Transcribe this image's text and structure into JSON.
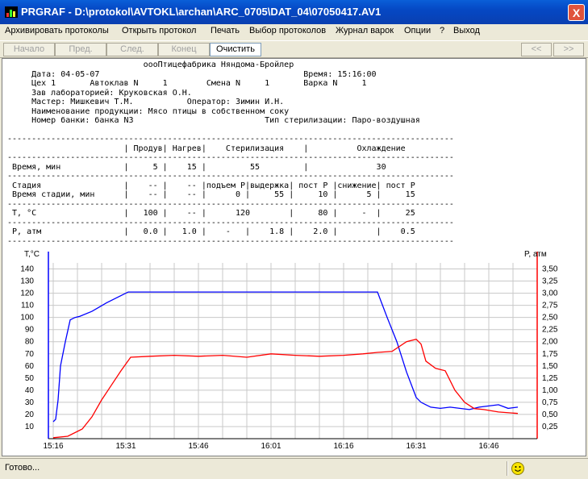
{
  "window": {
    "title": "PRGRAF - D:\\protokol\\AVTOKL\\archan\\ARC_0705\\DAT_04\\07050417.AV1",
    "close": "X"
  },
  "menu": [
    "Архивировать протоколы",
    "Открыть протокол",
    "Печать",
    "Выбор протоколов",
    "Журнал варок",
    "Опции",
    "?",
    "Выход"
  ],
  "toolbar": {
    "start": "Начало",
    "prev": "Пред.",
    "next": "След.",
    "end": "Конец",
    "clear": "Очистить",
    "rewind": "<<",
    "forward": ">>"
  },
  "report": {
    "lines": [
      "                            oooПтицефабрика Няндома-Бройлер",
      "     Дата: 04-05-07                                          Время: 15:16:00",
      "     Цех 1       Автоклав N     1        Смена N     1       Варка N     1",
      "     Зав лабораторией: Круковская О.Н.",
      "     Мастер: Мишкевич Т.М.           Оператор: Зимин И.Н.",
      "     Наименование продукции: Мясо птицы в собственном соку",
      "     Номер банки: банка N3                           Тип стерилизации: Паро-воздушная",
      "",
      "--------------------------------------------------------------------------------------------",
      "                        | Продув| Нагрев|    Стерилизация    |          Охлаждение",
      "--------------------------------------------------------------------------------------------",
      " Время, мин             |     5 |    15 |         55         |              30",
      "--------------------------------------------------------------------------------------------",
      " Стадия                 |    -- |    -- |подъем P|выдержка| пост P |снижение| пост P",
      " Время стадии, мин      |    -- |    -- |      0 |     55 |     10 |      5 |     15",
      "--------------------------------------------------------------------------------------------",
      " T, °C                  |   100 |    -- |      120        |     80 |     -  |     25",
      "--------------------------------------------------------------------------------------------",
      " P, атм                 |   0.0 |   1.0 |    -   |    1.8 |    2.0 |        |    0.5",
      "--------------------------------------------------------------------------------------------"
    ]
  },
  "chart_data": {
    "type": "line",
    "left_axis_label": "T,°C",
    "right_axis_label": "P, атм",
    "x_labels": [
      "15:16",
      "15:31",
      "15:46",
      "16:01",
      "16:16",
      "16:31",
      "16:46"
    ],
    "x_minutes": [
      0,
      15,
      30,
      45,
      60,
      75,
      90
    ],
    "xlim": [
      -1,
      100
    ],
    "left_ylim": [
      0,
      145
    ],
    "left_ticks": [
      10,
      20,
      30,
      40,
      50,
      60,
      70,
      80,
      90,
      100,
      110,
      120,
      130,
      140
    ],
    "right_ylim": [
      0,
      3.625
    ],
    "right_ticks": [
      0.25,
      0.5,
      0.75,
      1.0,
      1.25,
      1.5,
      1.75,
      2.0,
      2.25,
      2.5,
      2.75,
      3.0,
      3.25,
      3.5
    ],
    "right_tick_labels": [
      "0,25",
      "0,50",
      "0,75",
      "1,00",
      "1,25",
      "1,50",
      "1,75",
      "2,00",
      "2,25",
      "2,50",
      "2,75",
      "3,00",
      "3,25",
      "3,50"
    ],
    "grid": true,
    "series": [
      {
        "axis": "left",
        "color": "#0000ff",
        "x": [
          0,
          0.5,
          1.0,
          1.5,
          2.5,
          3.5,
          4.5,
          5.5,
          8,
          11,
          14,
          15.5,
          20,
          30,
          40,
          50,
          60,
          67,
          69,
          71,
          73,
          75,
          76,
          77,
          78,
          80,
          82,
          84,
          86,
          88,
          90,
          92,
          94,
          96
        ],
        "y": [
          14,
          16,
          32,
          60,
          80,
          98,
          100,
          101,
          105,
          112,
          118,
          121,
          121,
          121,
          121,
          121,
          121,
          121,
          100,
          80,
          55,
          34,
          30,
          28,
          26,
          25,
          26,
          25,
          24,
          26,
          27,
          28,
          25,
          26
        ]
      },
      {
        "axis": "right",
        "color": "#ff0000",
        "x": [
          0,
          3,
          6,
          8,
          10,
          12,
          14,
          16,
          20,
          25,
          30,
          35,
          40,
          45,
          50,
          55,
          60,
          64,
          67,
          70,
          73,
          75,
          76,
          77,
          79,
          81,
          83,
          85,
          87,
          89,
          92,
          96
        ],
        "y": [
          0.02,
          0.05,
          0.2,
          0.45,
          0.8,
          1.1,
          1.4,
          1.68,
          1.7,
          1.72,
          1.7,
          1.72,
          1.68,
          1.75,
          1.72,
          1.7,
          1.72,
          1.75,
          1.78,
          1.8,
          2.0,
          2.05,
          1.95,
          1.6,
          1.45,
          1.4,
          1.0,
          0.75,
          0.62,
          0.6,
          0.55,
          0.52
        ]
      }
    ]
  },
  "status": {
    "text": "Готово..."
  }
}
